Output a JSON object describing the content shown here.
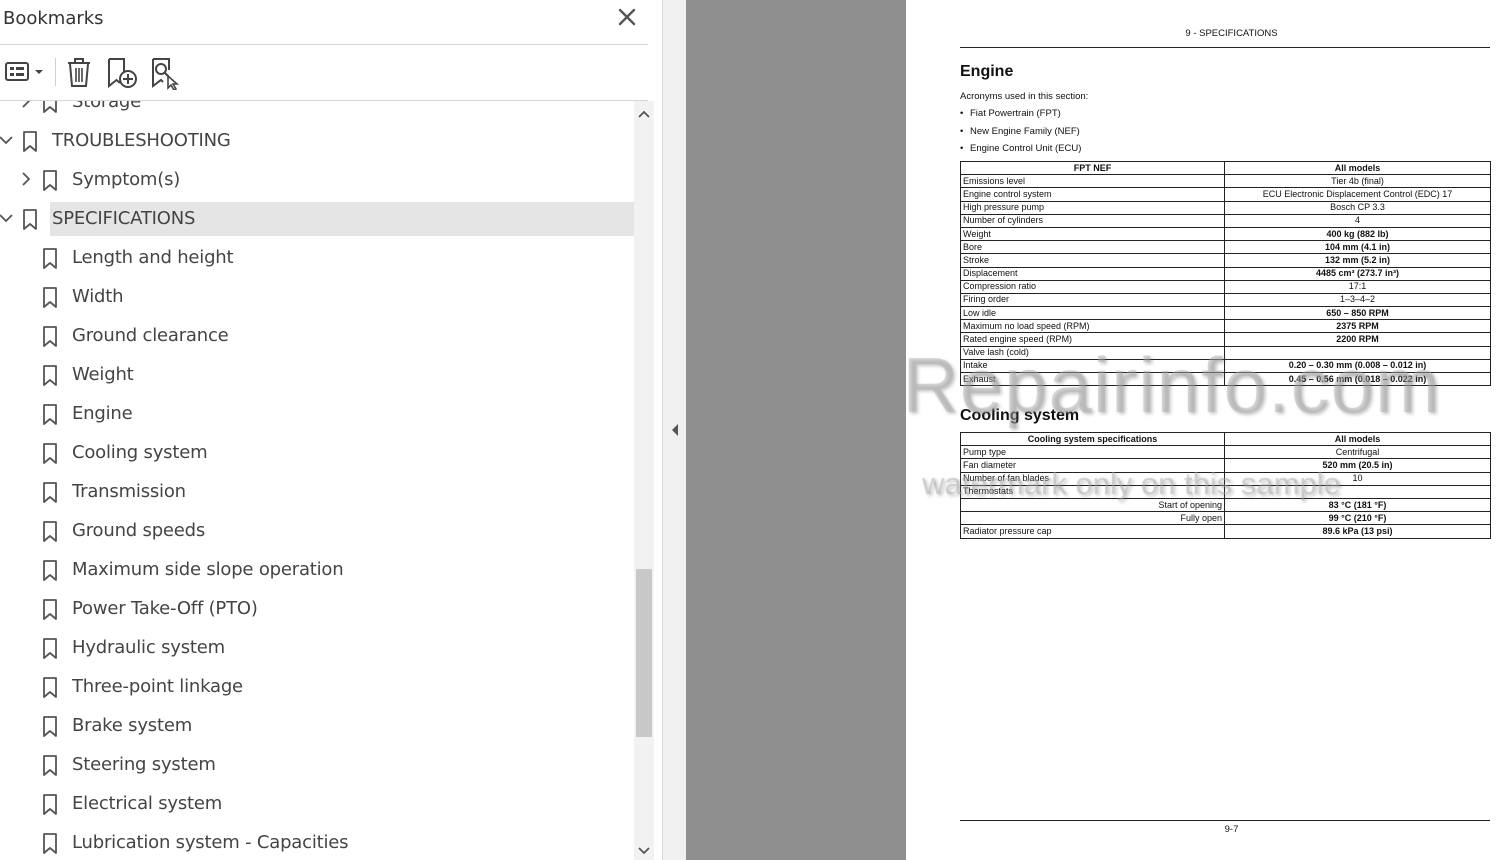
{
  "bookmarks_panel": {
    "title": "Bookmarks",
    "items": [
      {
        "label": "Storage",
        "indent": 1,
        "expanded": false,
        "has_children": true,
        "selected": false
      },
      {
        "label": "TROUBLESHOOTING",
        "indent": 0,
        "expanded": true,
        "has_children": true,
        "selected": false
      },
      {
        "label": "Symptom(s)",
        "indent": 1,
        "expanded": false,
        "has_children": true,
        "selected": false
      },
      {
        "label": "SPECIFICATIONS",
        "indent": 0,
        "expanded": true,
        "has_children": true,
        "selected": true
      },
      {
        "label": "Length and height",
        "indent": 1,
        "has_children": false,
        "selected": false
      },
      {
        "label": "Width",
        "indent": 1,
        "has_children": false,
        "selected": false
      },
      {
        "label": "Ground clearance",
        "indent": 1,
        "has_children": false,
        "selected": false
      },
      {
        "label": "Weight",
        "indent": 1,
        "has_children": false,
        "selected": false
      },
      {
        "label": "Engine",
        "indent": 1,
        "has_children": false,
        "selected": false
      },
      {
        "label": "Cooling system",
        "indent": 1,
        "has_children": false,
        "selected": false
      },
      {
        "label": "Transmission",
        "indent": 1,
        "has_children": false,
        "selected": false
      },
      {
        "label": "Ground speeds",
        "indent": 1,
        "has_children": false,
        "selected": false
      },
      {
        "label": "Maximum side slope operation",
        "indent": 1,
        "has_children": false,
        "selected": false
      },
      {
        "label": "Power Take-Off (PTO)",
        "indent": 1,
        "has_children": false,
        "selected": false
      },
      {
        "label": "Hydraulic system",
        "indent": 1,
        "has_children": false,
        "selected": false
      },
      {
        "label": "Three-point linkage",
        "indent": 1,
        "has_children": false,
        "selected": false
      },
      {
        "label": "Brake system",
        "indent": 1,
        "has_children": false,
        "selected": false
      },
      {
        "label": "Steering system",
        "indent": 1,
        "has_children": false,
        "selected": false
      },
      {
        "label": "Electrical system",
        "indent": 1,
        "has_children": false,
        "selected": false
      },
      {
        "label": "Lubrication system - Capacities",
        "indent": 1,
        "has_children": false,
        "selected": false
      }
    ],
    "icons": {
      "options": "list-options-icon",
      "delete": "trash-icon",
      "new_bookmark": "add-bookmark-icon",
      "find_bookmark": "find-current-bookmark-icon",
      "close": "close-icon"
    }
  },
  "document": {
    "header": "9 - SPECIFICATIONS",
    "engine_title": "Engine",
    "acronyms_intro": "Acronyms used in this section:",
    "acronyms": [
      "Fiat Powertrain (FPT)",
      "New Engine Family (NEF)",
      "Engine Control Unit (ECU)"
    ],
    "engine_table": {
      "headers": [
        "FPT NEF",
        "All models"
      ],
      "rows": [
        {
          "label": "Emissions level",
          "value": "Tier 4b (final)",
          "bold": false
        },
        {
          "label": "Engine control system",
          "value": "ECU Electronic Displacement Control (EDC) 17",
          "bold": false
        },
        {
          "label": "High pressure pump",
          "value": "Bosch CP 3.3",
          "bold": false
        },
        {
          "label": "Number of cylinders",
          "value": "4",
          "bold": false
        },
        {
          "label": "Weight",
          "value": "400 kg (882 lb)",
          "bold": true
        },
        {
          "label": "Bore",
          "value": "104 mm (4.1 in)",
          "bold": true
        },
        {
          "label": "Stroke",
          "value": "132 mm (5.2 in)",
          "bold": true
        },
        {
          "label": "Displacement",
          "value": "4485 cm³ (273.7 in³)",
          "bold": true
        },
        {
          "label": "Compression ratio",
          "value": "17:1",
          "bold": false
        },
        {
          "label": "Firing order",
          "value": "1–3–4–2",
          "bold": false
        },
        {
          "label": "Low idle",
          "value": "650 – 850 RPM",
          "bold": true
        },
        {
          "label": "Maximum no load speed (RPM)",
          "value": "2375 RPM",
          "bold": true
        },
        {
          "label": "Rated engine speed (RPM)",
          "value": "2200 RPM",
          "bold": true
        },
        {
          "label": "Valve lash (cold)",
          "value": "",
          "bold": false
        },
        {
          "label": "Intake",
          "value": "0.20 – 0.30 mm (0.008 – 0.012 in)",
          "bold": true
        },
        {
          "label": "Exhaust",
          "value": "0.45 – 0.56 mm (0.018 – 0.022 in)",
          "bold": true
        }
      ]
    },
    "cooling_title": "Cooling system",
    "cooling_table": {
      "headers": [
        "Cooling system specifications",
        "All models"
      ],
      "rows": [
        {
          "label": "Pump type",
          "value": "Centrifugal",
          "bold": false,
          "align": "left"
        },
        {
          "label": "Fan diameter",
          "value": "520 mm (20.5 in)",
          "bold": true,
          "align": "left"
        },
        {
          "label": "Number of fan blades",
          "value": "10",
          "bold": false,
          "align": "left"
        },
        {
          "label": "Thermostats",
          "value": "",
          "bold": false,
          "align": "left"
        },
        {
          "label": "Start of opening",
          "value": "83 °C (181 °F)",
          "bold": true,
          "align": "right"
        },
        {
          "label": "Fully open",
          "value": "99 °C (210 °F)",
          "bold": true,
          "align": "right"
        },
        {
          "label": "Radiator pressure cap",
          "value": "89.6 kPa (13 psi)",
          "bold": true,
          "align": "left"
        }
      ]
    },
    "page_number": "9-7",
    "watermark_main": "eRepairinfo.com",
    "watermark_sub": "watermark only on this sample"
  }
}
